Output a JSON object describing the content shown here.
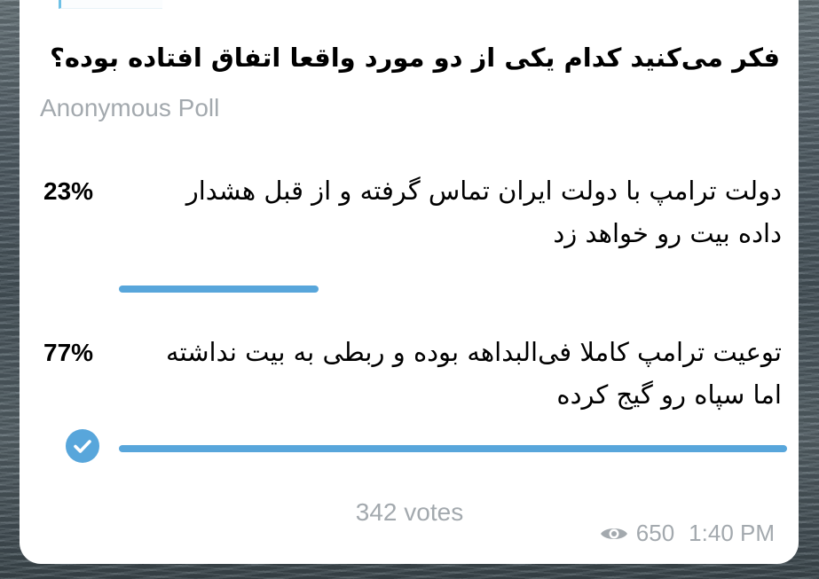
{
  "poll": {
    "question": "فکر می‌کنید کدام یکی از دو مورد واقعا اتفاق افتاده بوده؟",
    "type_label": "Anonymous Poll",
    "options": [
      {
        "percent_label": "23%",
        "text": "دولت ترامپ با دولت ایران تماس گرفته و از قبل هشدار داده بیت رو خواهد زد",
        "share": 0.23,
        "selected": false
      },
      {
        "percent_label": "77%",
        "text": "توعیت ترامپ کاملا فی‌البداهه بوده و ربطی به بیت نداشته اما سپاه رو گیج کرده",
        "share": 0.77,
        "selected": true
      }
    ],
    "total_votes": "342 votes"
  },
  "message": {
    "view_count": "650",
    "time": "1:40 PM"
  },
  "icons": {
    "selected_check": "check-circle-icon",
    "views": "eye-icon"
  },
  "colors": {
    "accent": "#58a6db",
    "secondary_text": "#a3a9ae",
    "bubble": "#ffffff"
  }
}
